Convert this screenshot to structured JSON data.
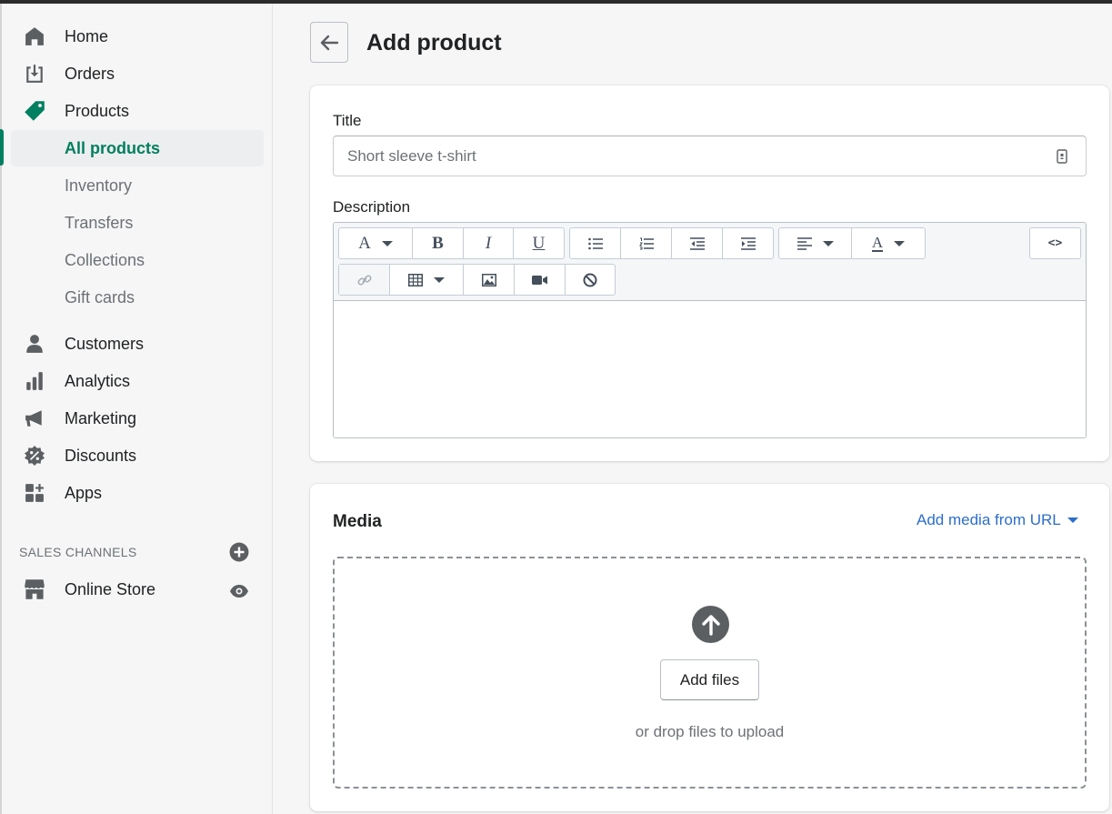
{
  "sidebar": {
    "items": [
      {
        "label": "Home",
        "icon": "home-icon"
      },
      {
        "label": "Orders",
        "icon": "orders-icon"
      },
      {
        "label": "Products",
        "icon": "tag-icon"
      },
      {
        "label": "All products"
      },
      {
        "label": "Inventory"
      },
      {
        "label": "Transfers"
      },
      {
        "label": "Collections"
      },
      {
        "label": "Gift cards"
      },
      {
        "label": "Customers",
        "icon": "person-icon"
      },
      {
        "label": "Analytics",
        "icon": "bar-chart-icon"
      },
      {
        "label": "Marketing",
        "icon": "megaphone-icon"
      },
      {
        "label": "Discounts",
        "icon": "discount-badge-icon"
      },
      {
        "label": "Apps",
        "icon": "apps-icon"
      }
    ],
    "sales_channels": {
      "title": "SALES CHANNELS",
      "items": [
        {
          "label": "Online Store",
          "icon": "store-icon"
        }
      ]
    },
    "accent_color": "#008060"
  },
  "page": {
    "title": "Add product"
  },
  "product_form": {
    "title_label": "Title",
    "title_placeholder": "Short sleeve t-shirt",
    "description_label": "Description",
    "toolbar_buttons": [
      "Font",
      "Bold",
      "Italic",
      "Underline",
      "Bulleted list",
      "Numbered list",
      "Outdent",
      "Indent",
      "Align",
      "Text color",
      "Show HTML",
      "Link",
      "Table",
      "Image",
      "Video",
      "Clear formatting"
    ],
    "toolbar_glyphs": {
      "font": "A",
      "bold": "B",
      "italic": "I",
      "underline": "U",
      "color": "A",
      "html": "<>"
    }
  },
  "media": {
    "title": "Media",
    "add_from_url": "Add media from URL",
    "add_files": "Add files",
    "drop_hint": "or drop files to upload",
    "link_color": "#2c6ecb"
  }
}
